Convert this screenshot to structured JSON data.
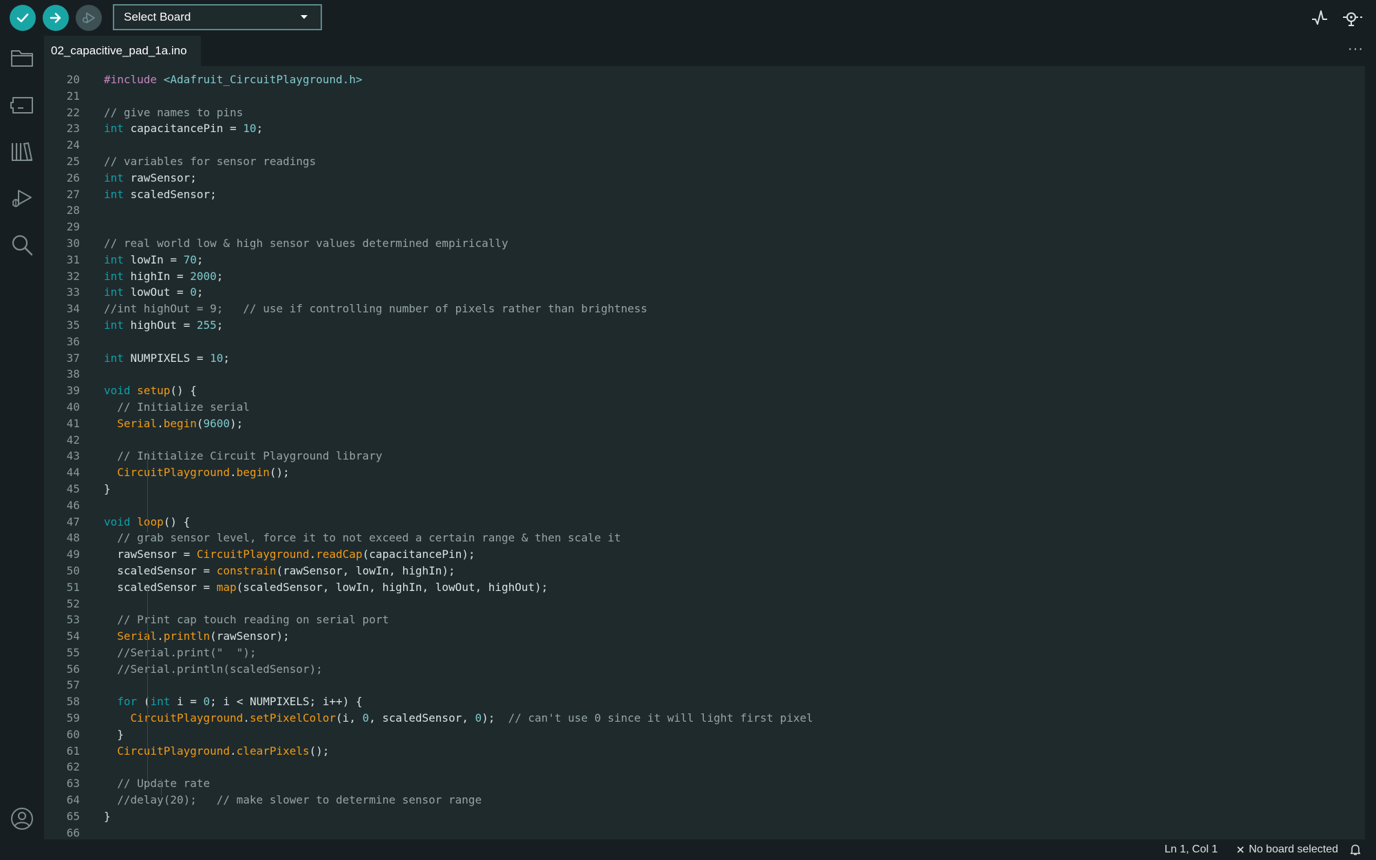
{
  "toolbar": {
    "verify_icon": "check-icon",
    "upload_icon": "arrow-right-icon",
    "debug_icon": "debug-icon",
    "board_select": "Select Board",
    "serial_plotter_icon": "pulse-icon",
    "serial_monitor_icon": "monitor-icon"
  },
  "sidebar": {
    "items": [
      "folder-icon",
      "boards-icon",
      "library-icon",
      "debug-icon",
      "search-icon"
    ],
    "bottom": "account-icon"
  },
  "tab": {
    "label": "02_capacitive_pad_1a.ino",
    "more": "···"
  },
  "editor": {
    "lines": [
      {
        "n": "20",
        "t": [
          [
            "pp",
            "#include "
          ],
          [
            "st",
            "<Adafruit_CircuitPlayground.h>"
          ]
        ]
      },
      {
        "n": "21",
        "t": []
      },
      {
        "n": "22",
        "t": [
          [
            "cm",
            "// give names to pins"
          ]
        ]
      },
      {
        "n": "23",
        "t": [
          [
            "kw",
            "int"
          ],
          [
            "tx",
            " capacitancePin = "
          ],
          [
            "nm",
            "10"
          ],
          [
            "tx",
            ";"
          ]
        ]
      },
      {
        "n": "24",
        "t": []
      },
      {
        "n": "25",
        "t": [
          [
            "cm",
            "// variables for sensor readings"
          ]
        ]
      },
      {
        "n": "26",
        "t": [
          [
            "kw",
            "int"
          ],
          [
            "tx",
            " rawSensor;"
          ]
        ]
      },
      {
        "n": "27",
        "t": [
          [
            "kw",
            "int"
          ],
          [
            "tx",
            " scaledSensor;"
          ]
        ]
      },
      {
        "n": "28",
        "t": []
      },
      {
        "n": "29",
        "t": []
      },
      {
        "n": "30",
        "t": [
          [
            "cm",
            "// real world low & high sensor values determined empirically"
          ]
        ]
      },
      {
        "n": "31",
        "t": [
          [
            "kw",
            "int"
          ],
          [
            "tx",
            " lowIn = "
          ],
          [
            "nm",
            "70"
          ],
          [
            "tx",
            ";"
          ]
        ]
      },
      {
        "n": "32",
        "t": [
          [
            "kw",
            "int"
          ],
          [
            "tx",
            " highIn = "
          ],
          [
            "nm",
            "2000"
          ],
          [
            "tx",
            ";"
          ]
        ]
      },
      {
        "n": "33",
        "t": [
          [
            "kw",
            "int"
          ],
          [
            "tx",
            " lowOut = "
          ],
          [
            "nm",
            "0"
          ],
          [
            "tx",
            ";"
          ]
        ]
      },
      {
        "n": "34",
        "t": [
          [
            "cm",
            "//int highOut = 9;   // use if controlling number of pixels rather than brightness"
          ]
        ]
      },
      {
        "n": "35",
        "t": [
          [
            "kw",
            "int"
          ],
          [
            "tx",
            " highOut = "
          ],
          [
            "nm",
            "255"
          ],
          [
            "tx",
            ";"
          ]
        ]
      },
      {
        "n": "36",
        "t": []
      },
      {
        "n": "37",
        "t": [
          [
            "kw",
            "int"
          ],
          [
            "tx",
            " NUMPIXELS = "
          ],
          [
            "nm",
            "10"
          ],
          [
            "tx",
            ";"
          ]
        ]
      },
      {
        "n": "38",
        "t": []
      },
      {
        "n": "39",
        "t": [
          [
            "kw",
            "void"
          ],
          [
            "tx",
            " "
          ],
          [
            "fn",
            "setup"
          ],
          [
            "tx",
            "() {"
          ]
        ]
      },
      {
        "n": "40",
        "t": [
          [
            "tx",
            "  "
          ],
          [
            "cm",
            "// Initialize serial"
          ]
        ]
      },
      {
        "n": "41",
        "t": [
          [
            "tx",
            "  "
          ],
          [
            "fn",
            "Serial"
          ],
          [
            "tx",
            "."
          ],
          [
            "fn",
            "begin"
          ],
          [
            "tx",
            "("
          ],
          [
            "nm",
            "9600"
          ],
          [
            "tx",
            ");"
          ]
        ]
      },
      {
        "n": "42",
        "t": []
      },
      {
        "n": "43",
        "t": [
          [
            "tx",
            "  "
          ],
          [
            "cm",
            "// Initialize Circuit Playground library"
          ]
        ]
      },
      {
        "n": "44",
        "t": [
          [
            "tx",
            "  "
          ],
          [
            "fn",
            "CircuitPlayground"
          ],
          [
            "tx",
            "."
          ],
          [
            "fn",
            "begin"
          ],
          [
            "tx",
            "();"
          ]
        ]
      },
      {
        "n": "45",
        "t": [
          [
            "tx",
            "}"
          ]
        ]
      },
      {
        "n": "46",
        "t": []
      },
      {
        "n": "47",
        "t": [
          [
            "kw",
            "void"
          ],
          [
            "tx",
            " "
          ],
          [
            "fn",
            "loop"
          ],
          [
            "tx",
            "() {"
          ]
        ]
      },
      {
        "n": "48",
        "t": [
          [
            "tx",
            "  "
          ],
          [
            "cm",
            "// grab sensor level, force it to not exceed a certain range & then scale it"
          ]
        ]
      },
      {
        "n": "49",
        "t": [
          [
            "tx",
            "  rawSensor = "
          ],
          [
            "fn",
            "CircuitPlayground"
          ],
          [
            "tx",
            "."
          ],
          [
            "fn",
            "readCap"
          ],
          [
            "tx",
            "(capacitancePin);"
          ]
        ]
      },
      {
        "n": "50",
        "t": [
          [
            "tx",
            "  scaledSensor = "
          ],
          [
            "fn",
            "constrain"
          ],
          [
            "tx",
            "(rawSensor, lowIn, highIn);"
          ]
        ]
      },
      {
        "n": "51",
        "t": [
          [
            "tx",
            "  scaledSensor = "
          ],
          [
            "fn",
            "map"
          ],
          [
            "tx",
            "(scaledSensor, lowIn, highIn, lowOut, highOut);"
          ]
        ]
      },
      {
        "n": "52",
        "t": []
      },
      {
        "n": "53",
        "t": [
          [
            "tx",
            "  "
          ],
          [
            "cm",
            "// Print cap touch reading on serial port"
          ]
        ]
      },
      {
        "n": "54",
        "t": [
          [
            "tx",
            "  "
          ],
          [
            "fn",
            "Serial"
          ],
          [
            "tx",
            "."
          ],
          [
            "fn",
            "println"
          ],
          [
            "tx",
            "(rawSensor);"
          ]
        ]
      },
      {
        "n": "55",
        "t": [
          [
            "tx",
            "  "
          ],
          [
            "cm",
            "//Serial.print(\"  \");"
          ]
        ]
      },
      {
        "n": "56",
        "t": [
          [
            "tx",
            "  "
          ],
          [
            "cm",
            "//Serial.println(scaledSensor);"
          ]
        ]
      },
      {
        "n": "57",
        "t": []
      },
      {
        "n": "58",
        "t": [
          [
            "tx",
            "  "
          ],
          [
            "kw",
            "for"
          ],
          [
            "tx",
            " ("
          ],
          [
            "kw",
            "int"
          ],
          [
            "tx",
            " i = "
          ],
          [
            "nm",
            "0"
          ],
          [
            "tx",
            "; i < NUMPIXELS; i++) {"
          ]
        ]
      },
      {
        "n": "59",
        "t": [
          [
            "tx",
            "    "
          ],
          [
            "fn",
            "CircuitPlayground"
          ],
          [
            "tx",
            "."
          ],
          [
            "fn",
            "setPixelColor"
          ],
          [
            "tx",
            "(i, "
          ],
          [
            "nm",
            "0"
          ],
          [
            "tx",
            ", scaledSensor, "
          ],
          [
            "nm",
            "0"
          ],
          [
            "tx",
            ");  "
          ],
          [
            "cm",
            "// can't use 0 since it will light first pixel"
          ]
        ]
      },
      {
        "n": "60",
        "t": [
          [
            "tx",
            "  }"
          ]
        ]
      },
      {
        "n": "61",
        "t": [
          [
            "tx",
            "  "
          ],
          [
            "fn",
            "CircuitPlayground"
          ],
          [
            "tx",
            "."
          ],
          [
            "fn",
            "clearPixels"
          ],
          [
            "tx",
            "();"
          ]
        ]
      },
      {
        "n": "62",
        "t": []
      },
      {
        "n": "63",
        "t": [
          [
            "tx",
            "  "
          ],
          [
            "cm",
            "// Update rate"
          ]
        ]
      },
      {
        "n": "64",
        "t": [
          [
            "tx",
            "  "
          ],
          [
            "cm",
            "//delay(20);   // make slower to determine sensor range"
          ]
        ]
      },
      {
        "n": "65",
        "t": [
          [
            "tx",
            "}"
          ]
        ]
      },
      {
        "n": "66",
        "t": []
      }
    ]
  },
  "status": {
    "position": "Ln 1, Col 1",
    "board": "No board selected",
    "board_close_icon": "close-icon",
    "notification_icon": "bell-icon"
  },
  "colors": {
    "accent": "#1aa5a5",
    "keyword": "#0ca1a6",
    "function": "#f39c12",
    "comment": "#95a5a6",
    "preprocessor": "#c586c0",
    "editor_bg": "#1f2a2d",
    "chrome_bg": "#171e21"
  }
}
